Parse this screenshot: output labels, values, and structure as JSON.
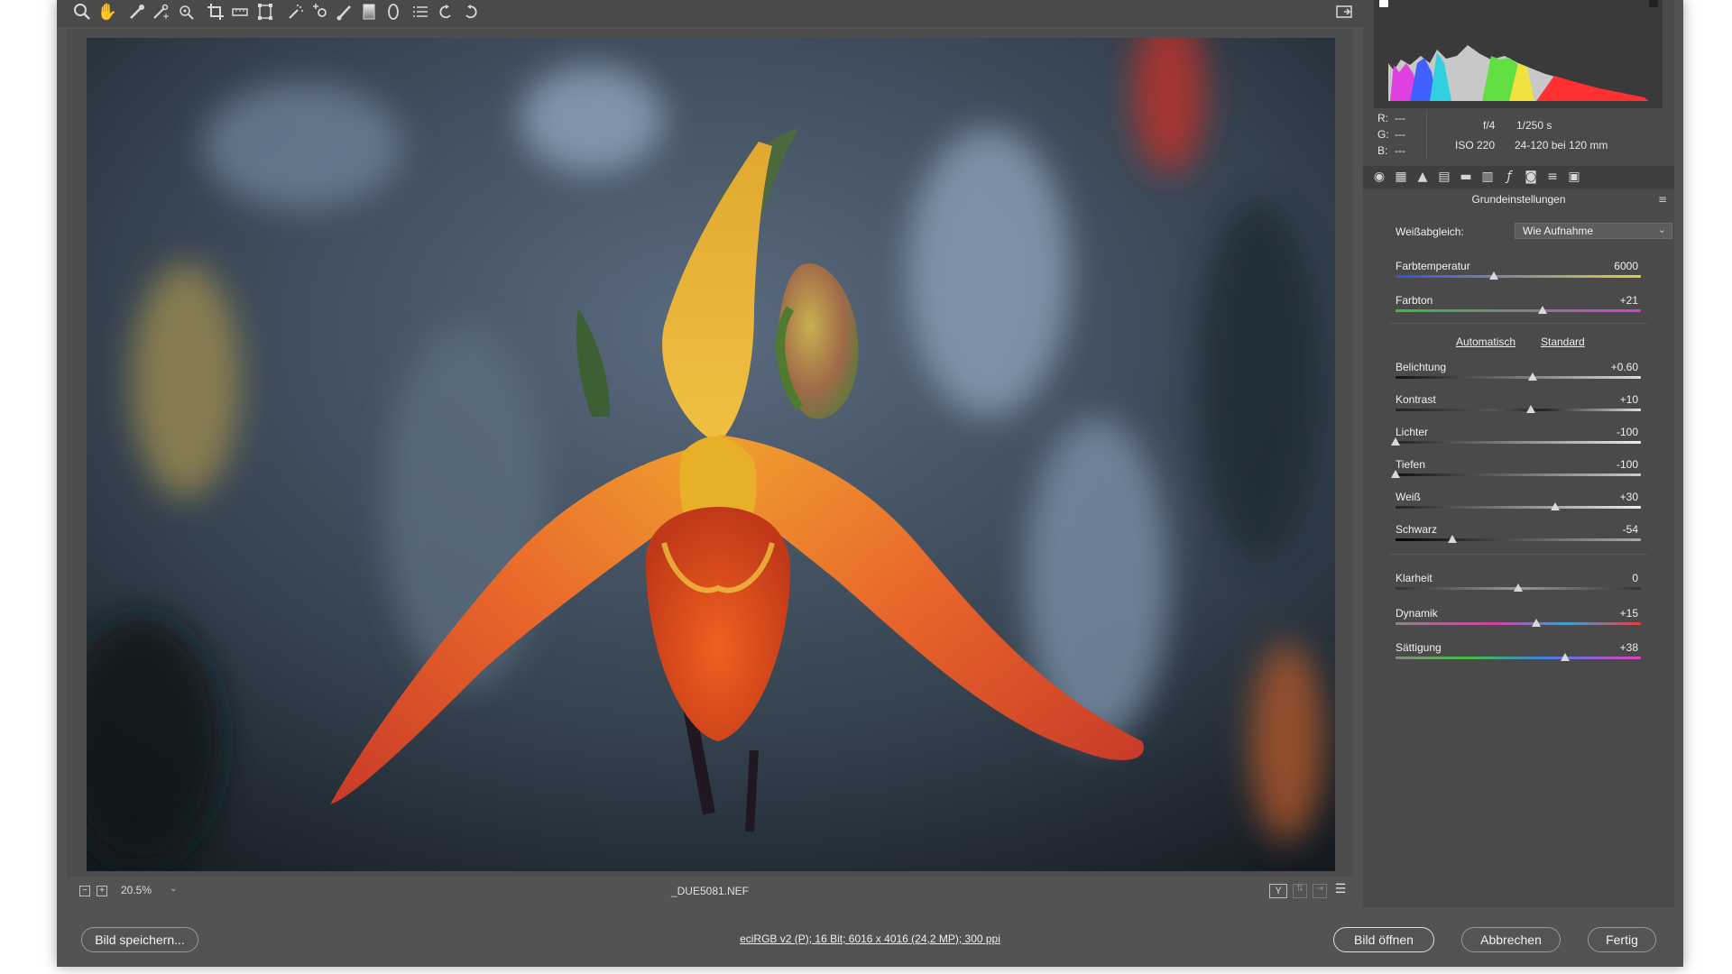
{
  "toolbar": {
    "tools": [
      "zoom-tool",
      "hand-tool",
      "white-balance-tool",
      "color-sampler-tool",
      "target-adjustment-tool",
      "crop-tool",
      "straighten-tool",
      "transform-tool",
      "spot-removal-tool",
      "red-eye-tool",
      "adjustment-brush-tool",
      "graduated-filter-tool",
      "radial-filter-tool",
      "preferences",
      "rotate-left",
      "rotate-right"
    ]
  },
  "viewport": {
    "zoom_label": "20.5%",
    "filename": "_DUE5081.NEF"
  },
  "histogram": {
    "rgb": {
      "r_label": "R:",
      "r_value": "---",
      "g_label": "G:",
      "g_value": "---",
      "b_label": "B:",
      "b_value": "---"
    },
    "aperture": "f/4",
    "shutter": "1/250 s",
    "iso": "ISO 220",
    "lens": "24-120 bei 120 mm"
  },
  "panel": {
    "title": "Grundeinstellungen",
    "white_balance_label": "Weißabgleich:",
    "white_balance_value": "Wie Aufnahme",
    "auto_link": "Automatisch",
    "default_link": "Standard",
    "sliders": [
      {
        "label": "Farbtemperatur",
        "value": "6000",
        "position": 0.4
      },
      {
        "label": "Farbton",
        "value": "+21",
        "position": 0.6
      },
      {
        "label": "Belichtung",
        "value": "+0.60",
        "position": 0.56
      },
      {
        "label": "Kontrast",
        "value": "+10",
        "position": 0.55
      },
      {
        "label": "Lichter",
        "value": "-100",
        "position": 0.0
      },
      {
        "label": "Tiefen",
        "value": "-100",
        "position": 0.0
      },
      {
        "label": "Weiß",
        "value": "+30",
        "position": 0.65
      },
      {
        "label": "Schwarz",
        "value": "-54",
        "position": 0.23
      },
      {
        "label": "Klarheit",
        "value": "0",
        "position": 0.5
      },
      {
        "label": "Dynamik",
        "value": "+15",
        "position": 0.575
      },
      {
        "label": "Sättigung",
        "value": "+38",
        "position": 0.69
      }
    ]
  },
  "footer": {
    "save_label": "Bild speichern...",
    "info_link": "eciRGB v2 (P); 16 Bit; 6016 x 4016 (24,2 MP); 300 ppi",
    "open_label": "Bild öffnen",
    "cancel_label": "Abbrechen",
    "done_label": "Fertig"
  },
  "colors": {
    "window_bg": "#535353",
    "panel_bg": "#4a4a4a",
    "accent_orange": "#e8731e",
    "accent_yellow": "#e8b020"
  }
}
